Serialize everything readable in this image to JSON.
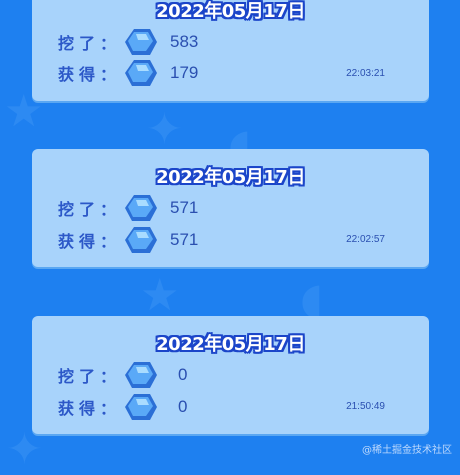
{
  "records": [
    {
      "date": "2022年05月17日",
      "mined_label": "挖了：",
      "mined_value": "583",
      "earned_label": "获得：",
      "earned_value": "179",
      "time": "22:03:21"
    },
    {
      "date": "2022年05月17日",
      "mined_label": "挖了：",
      "mined_value": "571",
      "earned_label": "获得：",
      "earned_value": "571",
      "time": "22:02:57"
    },
    {
      "date": "2022年05月17日",
      "mined_label": "挖了：",
      "mined_value": "0",
      "earned_label": "获得：",
      "earned_value": "0",
      "time": "21:50:49"
    }
  ],
  "watermark": "@稀土掘金技术社区",
  "icons": {
    "gem": "ore-gem-icon"
  },
  "colors": {
    "background": "#1e80f0",
    "card": "#a8d3fb",
    "label": "#2c58c8",
    "date_outline": "#1b45c9"
  }
}
